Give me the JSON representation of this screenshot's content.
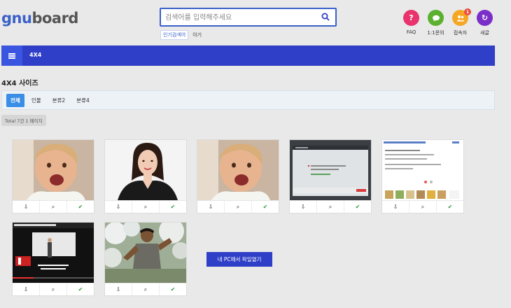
{
  "logo": {
    "part1": "gnu",
    "part2": "board"
  },
  "search": {
    "placeholder": "검색어를 입력해주세요"
  },
  "popular": {
    "active_label": "인기검색어",
    "tag": "아기"
  },
  "header_icons": [
    {
      "name": "faq",
      "label": "FAQ",
      "glyph": "?",
      "color": "#e8336c"
    },
    {
      "name": "qa",
      "label": "1:1문의",
      "glyph": "…",
      "color": "#5cb02f"
    },
    {
      "name": "visitors",
      "label": "접속자",
      "glyph": "●",
      "color": "#f5a623",
      "badge": "1"
    },
    {
      "name": "new",
      "label": "새글",
      "glyph": "↻",
      "color": "#7b2fc9"
    }
  ],
  "nav": {
    "title": "4X4"
  },
  "page_title": "4X4 사이즈",
  "categories": [
    {
      "label": "전체",
      "active": true
    },
    {
      "label": "인물",
      "active": false
    },
    {
      "label": "분류2",
      "active": false
    },
    {
      "label": "분류4",
      "active": false
    }
  ],
  "total": "Total 7건 1 페이지",
  "upload_button": "내 PC에서 파일열기",
  "card_actions": {
    "download": "download-icon",
    "zoom": "search-icon",
    "select": "check-icon"
  },
  "card_thumbs": [
    "baby-photo",
    "woman-portrait",
    "baby-photo",
    "screenshot-dark",
    "screenshot-doc",
    "presentation-video",
    "man-running"
  ],
  "colors": {
    "brand": "#2f3fc7",
    "accent": "#3a61c8",
    "active_tab": "#3a8ee6"
  }
}
